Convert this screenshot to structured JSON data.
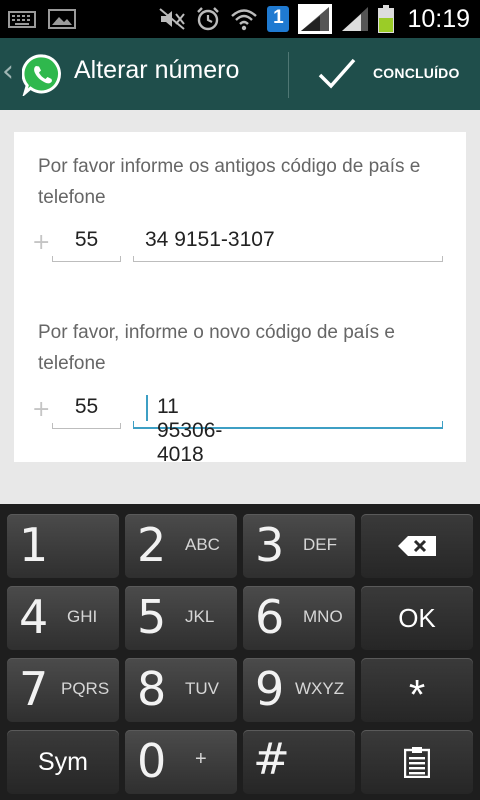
{
  "status_bar": {
    "time": "10:19",
    "sim_badge": "1",
    "icons": [
      "keyboard-icon",
      "image-icon",
      "mute-icon",
      "alarm-icon",
      "wifi-icon",
      "sim-badge-icon",
      "signal-icon",
      "signal-icon",
      "battery-icon"
    ]
  },
  "action_bar": {
    "back_glyph": "‹",
    "title": "Alterar número",
    "done_label": "CONCLUÍDO"
  },
  "form": {
    "old_prompt": "Por favor informe os antigos código de país e telefone",
    "old_plus": "+",
    "old_country_code": "55",
    "old_phone": "34 9151-3107",
    "new_prompt": "Por favor, informe o novo código de país e telefone",
    "new_plus": "+",
    "new_country_code": "55",
    "new_phone": "11 95306-4018"
  },
  "keyboard": {
    "keys": [
      {
        "digit": "1",
        "letters": ""
      },
      {
        "digit": "2",
        "letters": "ABC"
      },
      {
        "digit": "3",
        "letters": "DEF"
      },
      {
        "digit": "4",
        "letters": "GHI"
      },
      {
        "digit": "5",
        "letters": "JKL"
      },
      {
        "digit": "6",
        "letters": "MNO"
      },
      {
        "digit": "7",
        "letters": "PQRS"
      },
      {
        "digit": "8",
        "letters": "TUV"
      },
      {
        "digit": "9",
        "letters": "WXYZ"
      },
      {
        "digit": "0",
        "letters": "+"
      }
    ],
    "ok_label": "OK",
    "star_label": "*",
    "sym_label": "Sym",
    "hash_label": "#"
  },
  "colors": {
    "action_bar": "#1f4e4b",
    "accent": "#3d9fc4",
    "whatsapp_green": "#2fb84d"
  }
}
